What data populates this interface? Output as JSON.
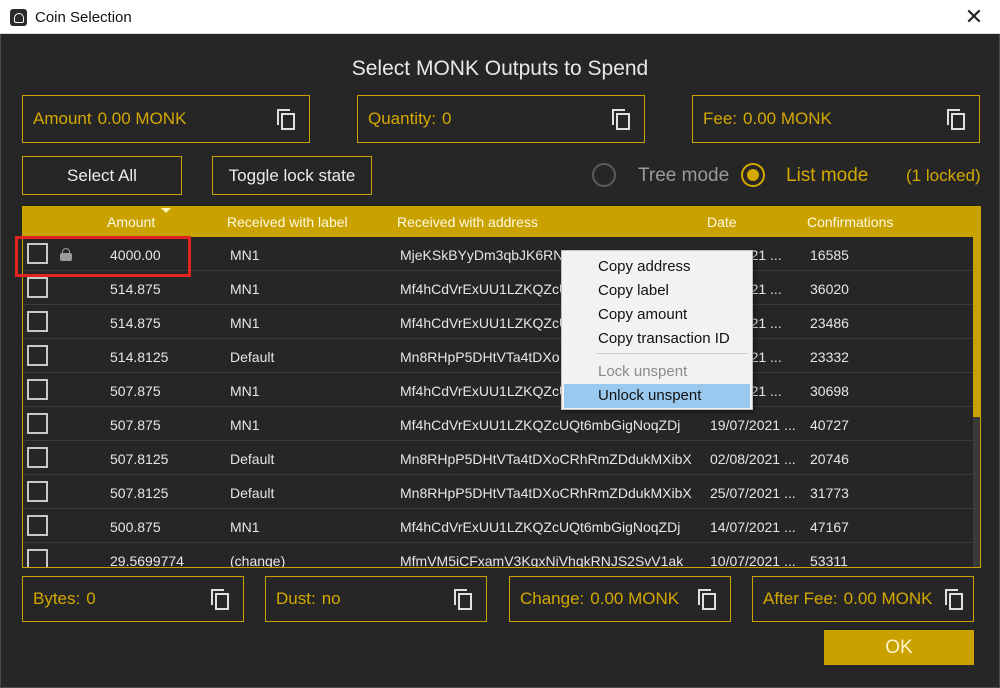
{
  "window": {
    "title": "Coin Selection",
    "close_glyph": "✕"
  },
  "heading": "Select MONK Outputs to Spend",
  "summary_top": {
    "amount": {
      "label": "Amount",
      "value": "0.00 MONK"
    },
    "quantity": {
      "label": "Quantity:",
      "value": "0"
    },
    "fee": {
      "label": "Fee:",
      "value": "0.00 MONK"
    }
  },
  "buttons": {
    "select_all": "Select All",
    "toggle_lock": "Toggle lock state",
    "ok": "OK"
  },
  "mode": {
    "tree": "Tree mode",
    "list": "List mode",
    "selected": "list",
    "locked_note": "(1 locked)"
  },
  "table": {
    "columns": [
      "Amount",
      "Received with label",
      "Received with address",
      "Date",
      "Confirmations"
    ],
    "rows": [
      {
        "amount": "4000.00",
        "label": "MN1",
        "address": "MjeKSkBYyDm3qbJK6RNc",
        "date": "2021 ...",
        "confirmations": "16585",
        "locked": true
      },
      {
        "amount": "514.875",
        "label": "MN1",
        "address": "Mf4hCdVrExUU1LZKQZcU",
        "date": "2021 ...",
        "confirmations": "36020"
      },
      {
        "amount": "514.875",
        "label": "MN1",
        "address": "Mf4hCdVrExUU1LZKQZcU",
        "date": "2021 ...",
        "confirmations": "23486"
      },
      {
        "amount": "514.8125",
        "label": "Default",
        "address": "Mn8RHpP5DHtVTa4tDXo",
        "date": "2021 ...",
        "confirmations": "23332"
      },
      {
        "amount": "507.875",
        "label": "MN1",
        "address": "Mf4hCdVrExUU1LZKQZcU",
        "date": "2021 ...",
        "confirmations": "30698"
      },
      {
        "amount": "507.875",
        "label": "MN1",
        "address": "Mf4hCdVrExUU1LZKQZcUQt6mbGigNoqZDj",
        "date": "19/07/2021 ...",
        "confirmations": "40727"
      },
      {
        "amount": "507.8125",
        "label": "Default",
        "address": "Mn8RHpP5DHtVTa4tDXoCRhRmZDdukMXibX",
        "date": "02/08/2021 ...",
        "confirmations": "20746"
      },
      {
        "amount": "507.8125",
        "label": "Default",
        "address": "Mn8RHpP5DHtVTa4tDXoCRhRmZDdukMXibX",
        "date": "25/07/2021 ...",
        "confirmations": "31773"
      },
      {
        "amount": "500.875",
        "label": "MN1",
        "address": "Mf4hCdVrExUU1LZKQZcUQt6mbGigNoqZDj",
        "date": "14/07/2021 ...",
        "confirmations": "47167"
      },
      {
        "amount": "29.5699774",
        "label": "(change)",
        "address": "MfmVM5iCFxamV3KqxNiVhqkRNJS2SvV1ak",
        "date": "10/07/2021 ...",
        "confirmations": "53311"
      }
    ]
  },
  "context_menu": {
    "items": [
      "Copy address",
      "Copy label",
      "Copy amount",
      "Copy transaction ID",
      "Lock unspent",
      "Unlock unspent"
    ],
    "disabled": [
      "Lock unspent"
    ],
    "active": "Unlock unspent"
  },
  "summary_bottom": {
    "bytes": {
      "label": "Bytes:",
      "value": "0"
    },
    "dust": {
      "label": "Dust:",
      "value": "no"
    },
    "change": {
      "label": "Change:",
      "value": "0.00 MONK"
    },
    "after_fee": {
      "label": "After Fee:",
      "value": "0.00 MONK"
    }
  },
  "colors": {
    "accent": "#c9a200",
    "background": "#262626",
    "menu_highlight": "#99c9ef",
    "annotation": "#e32222"
  },
  "icons": [
    "app-icon",
    "copy-icon",
    "lock-icon",
    "close-icon",
    "sort-arrow-icon"
  ]
}
